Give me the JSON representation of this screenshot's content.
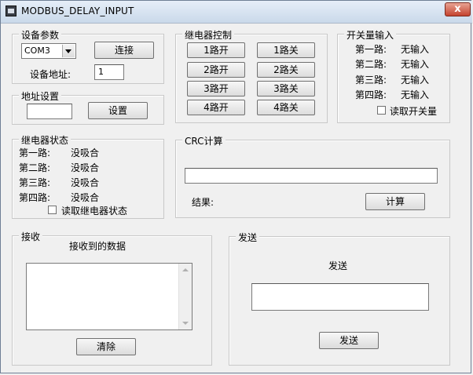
{
  "window": {
    "title": "MODBUS_DELAY_INPUT",
    "close_label": "x"
  },
  "device": {
    "legend": "设备参数",
    "port_value": "COM3",
    "connect_label": "连接",
    "address_label": "设备地址:",
    "address_value": "1"
  },
  "address_setting": {
    "legend": "地址设置",
    "input_value": "",
    "set_label": "设置"
  },
  "relay_control": {
    "legend": "继电器控制",
    "buttons": [
      {
        "on": "1路开",
        "off": "1路关"
      },
      {
        "on": "2路开",
        "off": "2路关"
      },
      {
        "on": "3路开",
        "off": "3路关"
      },
      {
        "on": "4路开",
        "off": "4路关"
      }
    ]
  },
  "switch_input": {
    "legend": "开关量输入",
    "rows": [
      {
        "name": "第一路:",
        "value": "无输入"
      },
      {
        "name": "第二路:",
        "value": "无输入"
      },
      {
        "name": "第三路:",
        "value": "无输入"
      },
      {
        "name": "第四路:",
        "value": "无输入"
      }
    ],
    "read_label": "读取开关量"
  },
  "relay_status": {
    "legend": "继电器状态",
    "rows": [
      {
        "name": "第一路:",
        "value": "没吸合"
      },
      {
        "name": "第二路:",
        "value": "没吸合"
      },
      {
        "name": "第三路:",
        "value": "没吸合"
      },
      {
        "name": "第四路:",
        "value": "没吸合"
      }
    ],
    "read_label": "读取继电器状态"
  },
  "crc": {
    "legend": "CRC计算",
    "input_value": "",
    "result_label": "结果:",
    "calc_label": "计算"
  },
  "receive": {
    "legend": "接收",
    "header": "接收到的数据",
    "content": "",
    "clear_label": "清除"
  },
  "send": {
    "legend": "发送",
    "header": "发送",
    "input_value": "",
    "send_label": "发送"
  }
}
